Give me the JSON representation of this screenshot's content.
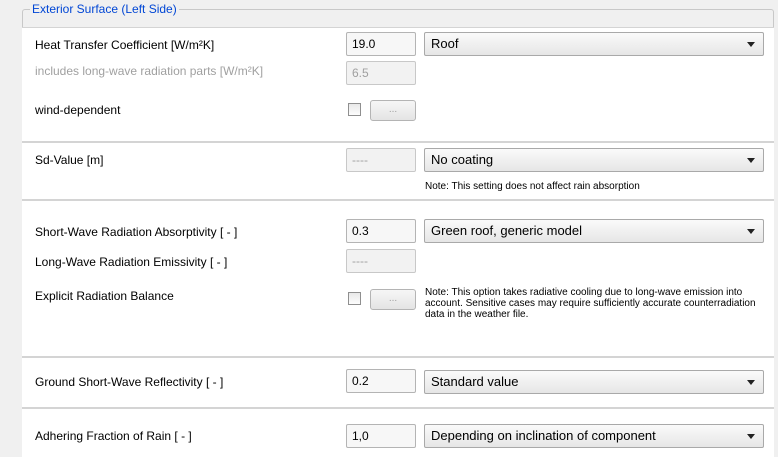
{
  "group": {
    "title": "Exterior Surface (Left Side)"
  },
  "heat_transfer": {
    "label": "Heat Transfer Coefficient [W/m²K]",
    "value": "19.0",
    "preset": "Roof",
    "longwave_label": "includes long-wave radiation parts [W/m²K]",
    "longwave_value": "6.5",
    "wind_label": "wind-dependent",
    "wind_checked": false,
    "wind_button": "..."
  },
  "sd_value": {
    "label": "Sd-Value  [m]",
    "value": "----",
    "preset": "No coating",
    "note": "Note: This setting does not affect rain absorption"
  },
  "radiation": {
    "shortwave_label": "Short-Wave Radiation Absorptivity [ - ]",
    "shortwave_value": "0.3",
    "preset": "Green roof, generic model",
    "longwave_label": "Long-Wave Radiation Emissivity [ - ]",
    "longwave_value": "----",
    "explicit_label": "Explicit Radiation Balance",
    "explicit_checked": false,
    "explicit_button": "...",
    "note": "Note: This option takes radiative cooling due to long-wave emission into account. Sensitive cases may require sufficiently accurate counterradiation data in the weather file."
  },
  "ground": {
    "label": "Ground Short-Wave Reflectivity [ - ]",
    "value": "0.2",
    "preset": "Standard value"
  },
  "rain": {
    "label": "Adhering Fraction of Rain [ - ]",
    "value": "1,0",
    "preset": "Depending on inclination of component"
  }
}
